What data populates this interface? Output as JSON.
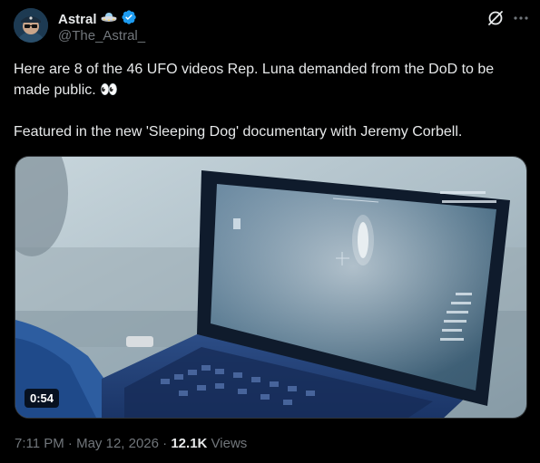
{
  "author": {
    "display_name": "Astral",
    "handle": "@The_Astral_",
    "name_emoji": "flying-saucer",
    "verified": true
  },
  "post": {
    "line1": "Here are 8 of the 46 UFO videos Rep. Luna demanded from the DoD to be made public. 👀",
    "line2": "Featured in the new 'Sleeping Dog' documentary with Jeremy Corbell."
  },
  "video": {
    "duration": "0:54"
  },
  "meta": {
    "time": "7:11 PM",
    "separator": " · ",
    "date": "May 12, 2026",
    "views_count": "12.1K",
    "views_label": " Views"
  },
  "colors": {
    "background": "#000000",
    "text": "#e7e9ea",
    "secondary": "#71767b",
    "verified": "#1d9bf0"
  }
}
